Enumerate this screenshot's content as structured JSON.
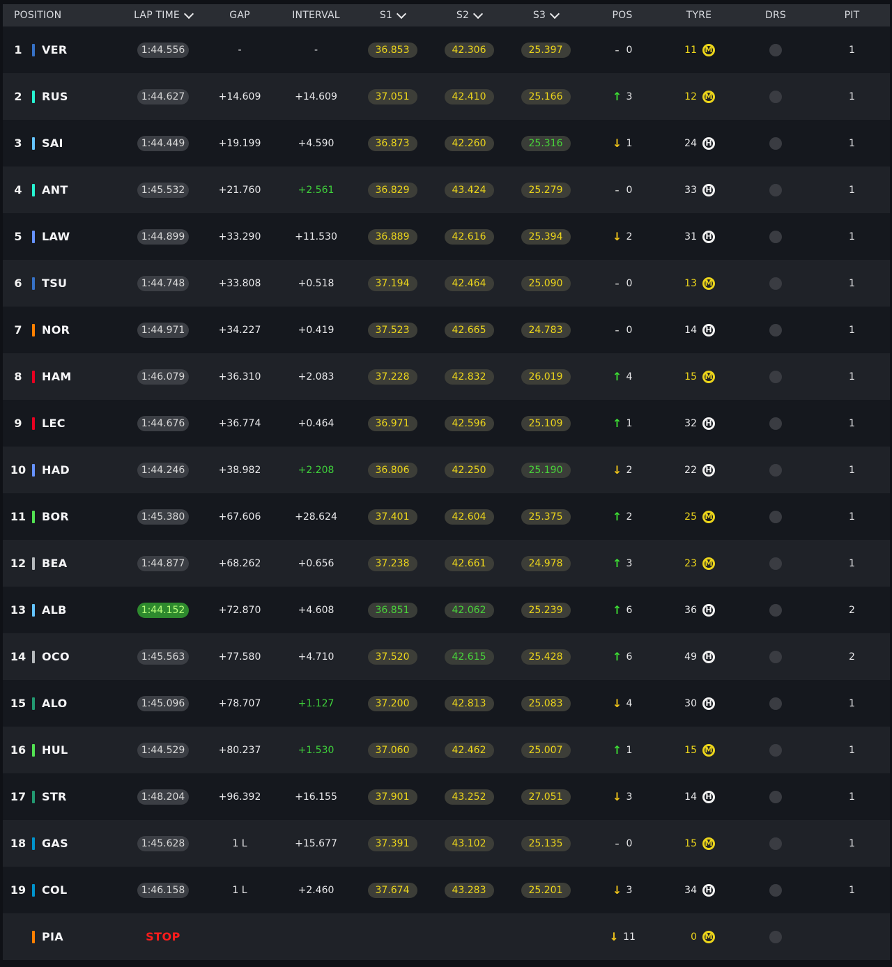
{
  "header": {
    "position": "POSITION",
    "lap_time": "LAP TIME",
    "gap": "GAP",
    "interval": "INTERVAL",
    "s1": "S1",
    "s2": "S2",
    "s3": "S3",
    "pos": "POS",
    "tyre": "TYRE",
    "drs": "DRS",
    "pit": "PIT"
  },
  "colors": {
    "sector_yellow": "#ecd51b",
    "green": "#3fd13b",
    "stop_red": "#ff1c1c"
  },
  "rows": [
    {
      "pos": "1",
      "team_color": "#3671c6",
      "code": "VER",
      "lap": "1:44.556",
      "gap": "-",
      "interval": "-",
      "s1": "36.853",
      "s2": "42.306",
      "s3": "25.397",
      "chg_dir": "same",
      "chg": "0",
      "tyre_laps": "11",
      "tyre": "M",
      "pit": "1"
    },
    {
      "pos": "2",
      "team_color": "#27f4d2",
      "code": "RUS",
      "lap": "1:44.627",
      "gap": "+14.609",
      "interval": "+14.609",
      "s1": "37.051",
      "s2": "42.410",
      "s3": "25.166",
      "chg_dir": "up",
      "chg": "3",
      "tyre_laps": "12",
      "tyre": "M",
      "pit": "1"
    },
    {
      "pos": "3",
      "team_color": "#64c4ff",
      "code": "SAI",
      "lap": "1:44.449",
      "gap": "+19.199",
      "interval": "+4.590",
      "s1": "36.873",
      "s2": "42.260",
      "s3": "25.316",
      "s3_green": true,
      "chg_dir": "down",
      "chg": "1",
      "tyre_laps": "24",
      "tyre": "H",
      "pit": "1"
    },
    {
      "pos": "4",
      "team_color": "#27f4d2",
      "code": "ANT",
      "lap": "1:45.532",
      "gap": "+21.760",
      "interval": "+2.561",
      "int_green": true,
      "s1": "36.829",
      "s2": "43.424",
      "s3": "25.279",
      "chg_dir": "same",
      "chg": "0",
      "tyre_laps": "33",
      "tyre": "H",
      "pit": "1"
    },
    {
      "pos": "5",
      "team_color": "#6692ff",
      "code": "LAW",
      "lap": "1:44.899",
      "gap": "+33.290",
      "interval": "+11.530",
      "s1": "36.889",
      "s2": "42.616",
      "s3": "25.394",
      "chg_dir": "down",
      "chg": "2",
      "tyre_laps": "31",
      "tyre": "H",
      "pit": "1"
    },
    {
      "pos": "6",
      "team_color": "#3671c6",
      "code": "TSU",
      "lap": "1:44.748",
      "gap": "+33.808",
      "interval": "+0.518",
      "s1": "37.194",
      "s2": "42.464",
      "s3": "25.090",
      "chg_dir": "same",
      "chg": "0",
      "tyre_laps": "13",
      "tyre": "M",
      "pit": "1"
    },
    {
      "pos": "7",
      "team_color": "#ff8000",
      "code": "NOR",
      "lap": "1:44.971",
      "gap": "+34.227",
      "interval": "+0.419",
      "s1": "37.523",
      "s2": "42.665",
      "s3": "24.783",
      "chg_dir": "same",
      "chg": "0",
      "tyre_laps": "14",
      "tyre": "H",
      "pit": "1"
    },
    {
      "pos": "8",
      "team_color": "#e80020",
      "code": "HAM",
      "lap": "1:46.079",
      "gap": "+36.310",
      "interval": "+2.083",
      "s1": "37.228",
      "s2": "42.832",
      "s3": "26.019",
      "chg_dir": "up",
      "chg": "4",
      "tyre_laps": "15",
      "tyre": "M",
      "pit": "1"
    },
    {
      "pos": "9",
      "team_color": "#e80020",
      "code": "LEC",
      "lap": "1:44.676",
      "gap": "+36.774",
      "interval": "+0.464",
      "s1": "36.971",
      "s2": "42.596",
      "s3": "25.109",
      "chg_dir": "up",
      "chg": "1",
      "tyre_laps": "32",
      "tyre": "H",
      "pit": "1"
    },
    {
      "pos": "10",
      "team_color": "#6692ff",
      "code": "HAD",
      "lap": "1:44.246",
      "gap": "+38.982",
      "interval": "+2.208",
      "int_green": true,
      "s1": "36.806",
      "s2": "42.250",
      "s3": "25.190",
      "s3_green": true,
      "chg_dir": "down",
      "chg": "2",
      "tyre_laps": "22",
      "tyre": "H",
      "pit": "1"
    },
    {
      "pos": "11",
      "team_color": "#52e252",
      "code": "BOR",
      "lap": "1:45.380",
      "gap": "+67.606",
      "interval": "+28.624",
      "s1": "37.401",
      "s2": "42.604",
      "s3": "25.375",
      "chg_dir": "up",
      "chg": "2",
      "tyre_laps": "25",
      "tyre": "M",
      "pit": "1"
    },
    {
      "pos": "12",
      "team_color": "#b6babd",
      "code": "BEA",
      "lap": "1:44.877",
      "gap": "+68.262",
      "interval": "+0.656",
      "s1": "37.238",
      "s2": "42.661",
      "s3": "24.978",
      "chg_dir": "up",
      "chg": "3",
      "tyre_laps": "23",
      "tyre": "M",
      "pit": "1"
    },
    {
      "pos": "13",
      "team_color": "#64c4ff",
      "code": "ALB",
      "lap": "1:44.152",
      "lap_best": true,
      "gap": "+72.870",
      "interval": "+4.608",
      "s1": "36.851",
      "s1_green": true,
      "s2": "42.062",
      "s2_green": true,
      "s3": "25.239",
      "chg_dir": "up",
      "chg": "6",
      "tyre_laps": "36",
      "tyre": "H",
      "pit": "2"
    },
    {
      "pos": "14",
      "team_color": "#b6babd",
      "code": "OCO",
      "lap": "1:45.563",
      "gap": "+77.580",
      "interval": "+4.710",
      "s1": "37.520",
      "s2": "42.615",
      "s2_green": true,
      "s3": "25.428",
      "chg_dir": "up",
      "chg": "6",
      "tyre_laps": "49",
      "tyre": "H",
      "pit": "2"
    },
    {
      "pos": "15",
      "team_color": "#229971",
      "code": "ALO",
      "lap": "1:45.096",
      "gap": "+78.707",
      "interval": "+1.127",
      "int_green": true,
      "s1": "37.200",
      "s2": "42.813",
      "s3": "25.083",
      "chg_dir": "down",
      "chg": "4",
      "tyre_laps": "30",
      "tyre": "H",
      "pit": "1"
    },
    {
      "pos": "16",
      "team_color": "#52e252",
      "code": "HUL",
      "lap": "1:44.529",
      "gap": "+80.237",
      "interval": "+1.530",
      "int_green": true,
      "s1": "37.060",
      "s2": "42.462",
      "s3": "25.007",
      "chg_dir": "up",
      "chg": "1",
      "tyre_laps": "15",
      "tyre": "M",
      "pit": "1"
    },
    {
      "pos": "17",
      "team_color": "#229971",
      "code": "STR",
      "lap": "1:48.204",
      "gap": "+96.392",
      "interval": "+16.155",
      "s1": "37.901",
      "s2": "43.252",
      "s3": "27.051",
      "chg_dir": "down",
      "chg": "3",
      "tyre_laps": "14",
      "tyre": "H",
      "pit": "1"
    },
    {
      "pos": "18",
      "team_color": "#0093cc",
      "code": "GAS",
      "lap": "1:45.628",
      "gap": "1 L",
      "interval": "+15.677",
      "s1": "37.391",
      "s2": "43.102",
      "s3": "25.135",
      "chg_dir": "same",
      "chg": "0",
      "tyre_laps": "15",
      "tyre": "M",
      "pit": "1"
    },
    {
      "pos": "19",
      "team_color": "#0093cc",
      "code": "COL",
      "lap": "1:46.158",
      "gap": "1 L",
      "interval": "+2.460",
      "s1": "37.674",
      "s2": "43.283",
      "s3": "25.201",
      "chg_dir": "down",
      "chg": "3",
      "tyre_laps": "34",
      "tyre": "H",
      "pit": "1"
    },
    {
      "pos": "",
      "team_color": "#ff8000",
      "code": "PIA",
      "stop": "STOP",
      "chg_dir": "down",
      "chg": "11",
      "tyre_laps": "0",
      "tyre": "M",
      "pit": ""
    }
  ]
}
